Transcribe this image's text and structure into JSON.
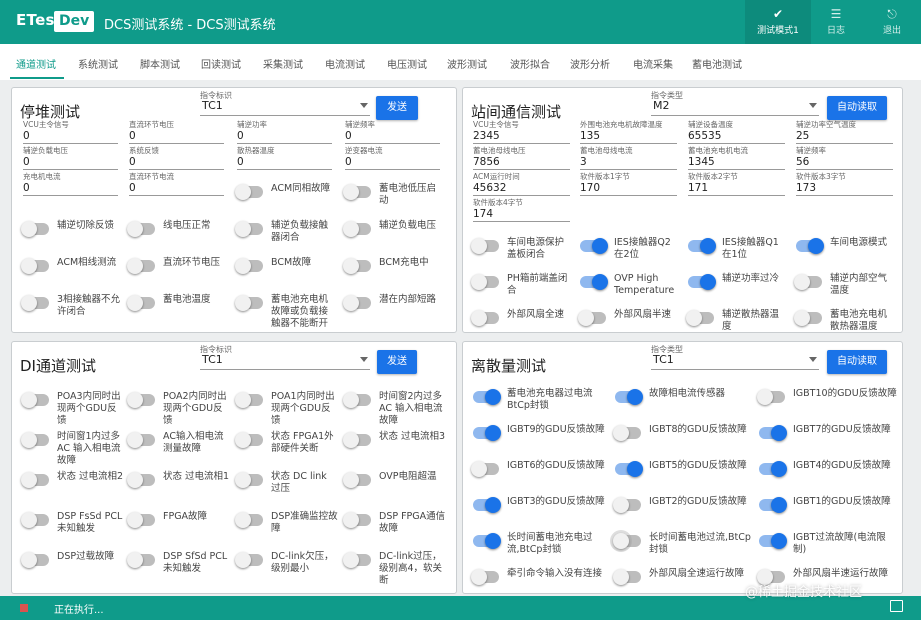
{
  "header": {
    "logo": "ETest",
    "badge": "Dev",
    "title": "DCS测试系统 - DCS测试系统",
    "buttons": [
      {
        "icon": "check-icon",
        "label": "测试模式1"
      },
      {
        "icon": "database-icon",
        "label": "日志"
      },
      {
        "icon": "exit-icon",
        "label": "退出"
      }
    ]
  },
  "tabs": [
    "通道测试",
    "系统测试",
    "脚本测试",
    "回读测试",
    "采集测试",
    "电流测试",
    "电压测试",
    "波形测试",
    "波形拟合",
    "波形分析",
    "电流采集",
    "蓄电池测试"
  ],
  "active_tab": "通道测试",
  "panels": {
    "tl": {
      "title": "停堆测试",
      "select_caption": "指令标识",
      "select_value": "TC1",
      "button": "发送",
      "fields": [
        {
          "label": "VCU主令信号",
          "value": "0"
        },
        {
          "label": "直流环节电压",
          "value": "0"
        },
        {
          "label": "辅逆功率",
          "value": "0"
        },
        {
          "label": "辅逆频率",
          "value": "0"
        },
        {
          "label": "辅逆负载电压",
          "value": "0"
        },
        {
          "label": "系统反馈",
          "value": "0"
        },
        {
          "label": "散热器温度",
          "value": "0"
        },
        {
          "label": "逆变器电流",
          "value": "0"
        },
        {
          "label": "充电机电流",
          "value": "0"
        },
        {
          "label": "直流环节电流",
          "value": "0"
        }
      ],
      "switches": [
        {
          "label": "ACM同相故障",
          "on": false
        },
        {
          "label": "蓄电池低压启动",
          "on": false
        },
        {
          "label": "辅逆切除反馈",
          "on": false
        },
        {
          "label": "线电压正常",
          "on": false
        },
        {
          "label": "辅逆负载接触器闭合",
          "on": false
        },
        {
          "label": "辅逆负载电压",
          "on": false
        },
        {
          "label": "ACM相线测流",
          "on": false
        },
        {
          "label": "直流环节电压",
          "on": false
        },
        {
          "label": "BCM故障",
          "on": false
        },
        {
          "label": "BCM充电中",
          "on": false
        },
        {
          "label": "3相接触器不允许闭合",
          "on": false
        },
        {
          "label": "蓄电池温度",
          "on": false
        },
        {
          "label": "蓄电池充电机故障或负载接触器不能断开",
          "on": false
        },
        {
          "label": "潜在内部短路",
          "on": false
        }
      ]
    },
    "tr": {
      "title": "站间通信测试",
      "select_caption": "指令类型",
      "select_value": "M2",
      "button": "自动读取",
      "fields": [
        {
          "label": "VCU主令信号",
          "value": "2345"
        },
        {
          "label": "外围电池充电机故障温度",
          "value": "135"
        },
        {
          "label": "辅逆设备温度",
          "value": "65535"
        },
        {
          "label": "辅逆功率空气温度",
          "value": "25"
        },
        {
          "label": "蓄电池母线电压",
          "value": "7856"
        },
        {
          "label": "蓄电池母线电流",
          "value": "3"
        },
        {
          "label": "蓄电池充电机电流",
          "value": "1345"
        },
        {
          "label": "辅逆频率",
          "value": "56"
        },
        {
          "label": "ACM运行时间",
          "value": "45632"
        },
        {
          "label": "软件版本1字节",
          "value": "170"
        },
        {
          "label": "软件版本2字节",
          "value": "171"
        },
        {
          "label": "软件版本3字节",
          "value": "173"
        },
        {
          "label": "软件版本4字节",
          "value": "174"
        }
      ],
      "switches": [
        {
          "label": "车间电源保护盖板闭合",
          "on": false
        },
        {
          "label": "IES接触器Q2在2位",
          "on": true
        },
        {
          "label": "IES接触器Q1在1位",
          "on": true
        },
        {
          "label": "车间电源模式",
          "on": true
        },
        {
          "label": "PH箱前端盖闭合",
          "on": false
        },
        {
          "label": "OVP High Temperature",
          "on": true
        },
        {
          "label": "辅逆功率过冷",
          "on": true
        },
        {
          "label": "辅逆内部空气温度",
          "on": false
        },
        {
          "label": "外部风扇全速",
          "on": false
        },
        {
          "label": "外部风扇半速",
          "on": false
        },
        {
          "label": "辅逆散热器温度",
          "on": false
        },
        {
          "label": "蓄电池充电机散热器温度",
          "on": false
        }
      ]
    },
    "bl": {
      "title": "DI通道测试",
      "select_caption": "指令标识",
      "select_value": "TC1",
      "button": "发送",
      "switches": [
        {
          "label": "POA3内同时出现两个GDU反馈",
          "on": false
        },
        {
          "label": "POA2内同时出现两个GDU反馈",
          "on": false
        },
        {
          "label": "POA1内同时出现两个GDU反馈",
          "on": false
        },
        {
          "label": "时间窗2内过多AC 输入相电流故障",
          "on": false
        },
        {
          "label": "时间窗1内过多AC 输入相电流故障",
          "on": false
        },
        {
          "label": "AC输入相电流测量故障",
          "on": false
        },
        {
          "label": "状态 FPGA1外部硬件关断",
          "on": false
        },
        {
          "label": "状态 过电流相3",
          "on": false
        },
        {
          "label": "状态 过电流相2",
          "on": false
        },
        {
          "label": "状态 过电流相1",
          "on": false
        },
        {
          "label": "状态 DC link 过压",
          "on": false
        },
        {
          "label": "OVP电阻超温",
          "on": false
        },
        {
          "label": "DSP FsSd PCL未知触发",
          "on": false
        },
        {
          "label": "FPGA故障",
          "on": false
        },
        {
          "label": "DSP准确监控故障",
          "on": false
        },
        {
          "label": "DSP FPGA通信故障",
          "on": false
        },
        {
          "label": "DSP过载故障",
          "on": false
        },
        {
          "label": "DSP SfSd PCL未知触发",
          "on": false
        },
        {
          "label": "DC-link欠压，级别最小",
          "on": false
        },
        {
          "label": "DC-link过压，级别高4，软关断",
          "on": false
        }
      ]
    },
    "br": {
      "title": "离散量测试",
      "select_caption": "指令类型",
      "select_value": "TC1",
      "button": "自动读取",
      "switches": [
        {
          "label": "蓄电池充电器过电流BtCp封锁",
          "on": true
        },
        {
          "label": "故障相电流传感器",
          "on": true
        },
        {
          "label": "IGBT10的GDU反馈故障",
          "on": false
        },
        {
          "label": "IGBT9的GDU反馈故障",
          "on": true
        },
        {
          "label": "IGBT8的GDU反馈故障",
          "on": false
        },
        {
          "label": "IGBT7的GDU反馈故障",
          "on": true
        },
        {
          "label": "IGBT6的GDU反馈故障",
          "on": false
        },
        {
          "label": "IGBT5的GDU反馈故障",
          "on": true
        },
        {
          "label": "IGBT4的GDU反馈故障",
          "on": true
        },
        {
          "label": "IGBT3的GDU反馈故障",
          "on": true
        },
        {
          "label": "IGBT2的GDU反馈故障",
          "on": false
        },
        {
          "label": "IGBT1的GDU反馈故障",
          "on": true
        },
        {
          "label": "长时间蓄电池充电过流,BtCp封锁",
          "on": true
        },
        {
          "label": "长时间蓄电池过流,BtCp封锁",
          "on": false,
          "highlight": true
        },
        {
          "label": "IGBT过流故障(电流限制)",
          "on": true
        },
        {
          "label": "牵引命令输入没有连接",
          "on": false
        },
        {
          "label": "外部风扇全速运行故障",
          "on": false
        },
        {
          "label": "外部风扇半速运行故障",
          "on": false
        }
      ]
    }
  },
  "status": {
    "text": "正在执行..."
  },
  "watermark": "@稀土掘金技术社区"
}
